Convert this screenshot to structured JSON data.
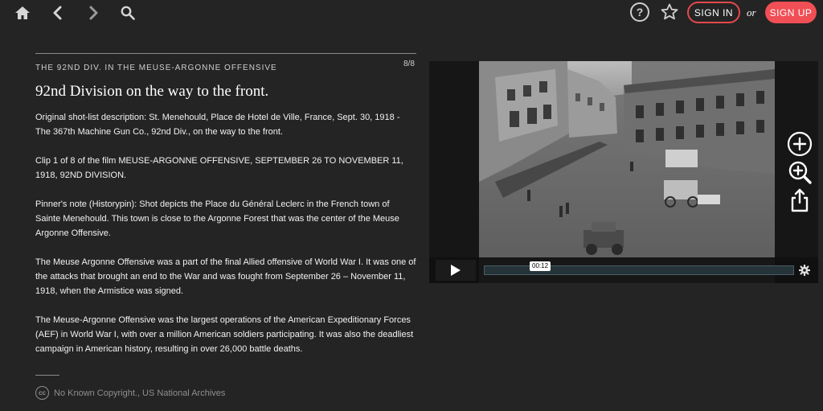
{
  "topbar": {
    "home_icon": "home-icon",
    "back_icon": "chevron-left-icon",
    "forward_icon": "chevron-right-icon",
    "search_icon": "search-icon",
    "help_label": "?",
    "star_icon": "star-icon",
    "signin_label": "SIGN IN",
    "or_label": "or",
    "signup_label": "SIGN UP",
    "accent_color": "#ef4f55"
  },
  "content": {
    "series_title": "THE 92ND DIV. IN THE MEUSE-ARGONNE OFFENSIVE",
    "counter": "8/8",
    "title": "92nd Division on the way to the front.",
    "paragraphs": [
      "Original shot-list description: St. Menehould, Place de Hotel de Ville, France, Sept. 30, 1918 - The 367th Machine Gun Co., 92nd Div., on the way to the front.",
      "Clip 1 of 8 of the film MEUSE-ARGONNE OFFENSIVE, SEPTEMBER 26 TO NOVEMBER 11, 1918, 92ND DIVISION.",
      "Pinner's note (Historypin): Shot depicts the Place du Général Leclerc in the French town of Sainte Menehould. This town is close to the Argonne Forest that was the center of the Meuse Argonne Offensive.",
      "The Meuse Argonne Offensive was a part of the final Allied offensive of World War I. It was one of the attacks that brought an end to the War and was fought from September 26 – November 11, 1918, when the Armistice was signed.",
      "The Meuse-Argonne Offensive was the largest operations of the American Expeditionary Forces (AEF) in World War I, with over a million American soldiers participating. It was also the deadliest campaign in American history, resulting in over 26,000 battle deaths."
    ],
    "license_icon": "cc",
    "license": "No Known Copyright., US National Archives"
  },
  "video": {
    "time": "00:12",
    "play_icon": "play-icon",
    "settings_icon": "gear-icon"
  },
  "side_tools": {
    "add_icon": "plus-circle-icon",
    "zoom_icon": "zoom-in-icon",
    "share_icon": "share-icon"
  }
}
